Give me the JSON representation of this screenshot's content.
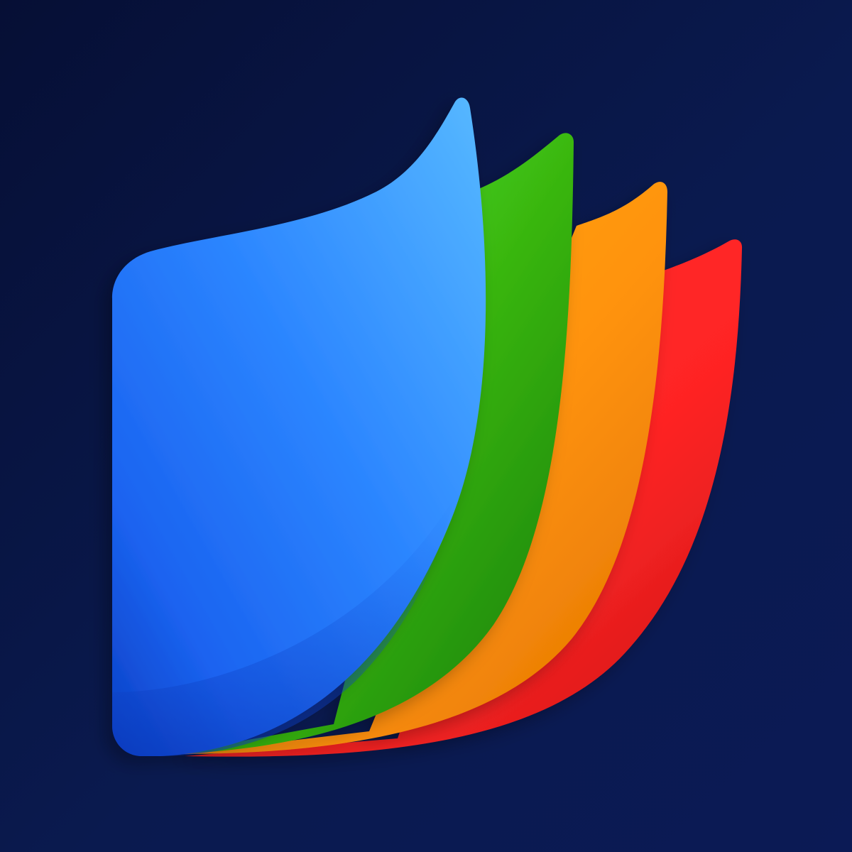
{
  "background": {
    "top_left": "#060f35",
    "bottom_right": "#0b1a55"
  },
  "logo": {
    "icon": "stacked-pages-icon",
    "pages": [
      {
        "name": "red-page",
        "color_light": "#ff2a2a",
        "color_dark": "#d61b1b"
      },
      {
        "name": "orange-page",
        "color_light": "#ff9a0d",
        "color_dark": "#ef7f00"
      },
      {
        "name": "green-page",
        "color_light": "#4fd41a",
        "color_dark": "#1f8d0c"
      },
      {
        "name": "blue-page",
        "color_light": "#54b4ff",
        "color_dark": "#0a45c9"
      }
    ]
  }
}
